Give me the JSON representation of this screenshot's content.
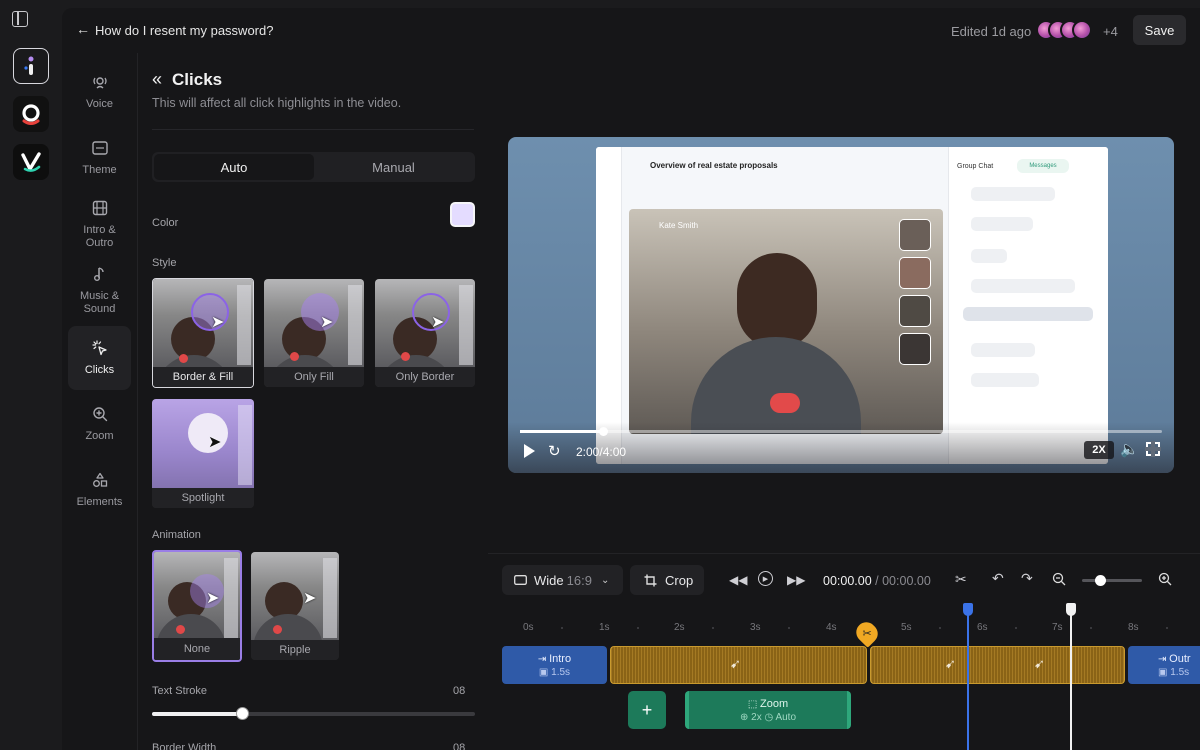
{
  "topbar": {
    "doc_title": "How do I resent my password?",
    "edited": "Edited 1d ago",
    "extra_collaborators": "+4",
    "save_label": "Save"
  },
  "apps": [
    {
      "name": "i-app",
      "glyph": "i"
    },
    {
      "name": "o-app",
      "glyph": "o"
    },
    {
      "name": "v-app",
      "glyph": "v"
    }
  ],
  "nav": {
    "voice": "Voice",
    "theme": "Theme",
    "intro_outro": "Intro & Outro",
    "music_sound": "Music & Sound",
    "clicks": "Clicks",
    "zoom": "Zoom",
    "elements": "Elements"
  },
  "panel": {
    "title": "Clicks",
    "subtitle": "This will affect all click highlights in the video.",
    "mode_auto": "Auto",
    "mode_manual": "Manual",
    "color_label": "Color",
    "color_value": "#e4dcff",
    "style_label": "Style",
    "styles": [
      "Border & Fill",
      "Only Fill",
      "Only Border",
      "Spotlight"
    ],
    "selected_style": "Border & Fill",
    "animation_label": "Animation",
    "animations": [
      "None",
      "Ripple"
    ],
    "selected_animation": "None",
    "text_stroke_label": "Text Stroke",
    "text_stroke_value": "08",
    "text_stroke_fraction": 0.28,
    "border_width_label": "Border Width",
    "border_width_value": "08"
  },
  "video": {
    "screen_title": "Overview of real estate proposals",
    "chat_title": "Group Chat",
    "chat_tab": "Messages",
    "publisher_name": "Kate Smith",
    "time_display": "2:00/4:00",
    "progress_fraction": 0.5,
    "speed": "2X"
  },
  "timeline": {
    "aspect_label": "Wide",
    "aspect_ratio": "16:9",
    "crop_label": "Crop",
    "current_time": "00:00.00",
    "total_time": "00:00.00",
    "ruler": [
      "0s",
      "1s",
      "2s",
      "3s",
      "4s",
      "5s",
      "6s",
      "7s",
      "8s"
    ],
    "intro_clip": {
      "label": "Intro",
      "duration": "1.5s"
    },
    "outro_clip": {
      "label": "Outr",
      "duration": "1.5s"
    },
    "zoom_clip": {
      "label": "Zoom",
      "level": "2x",
      "mode": "Auto"
    }
  }
}
